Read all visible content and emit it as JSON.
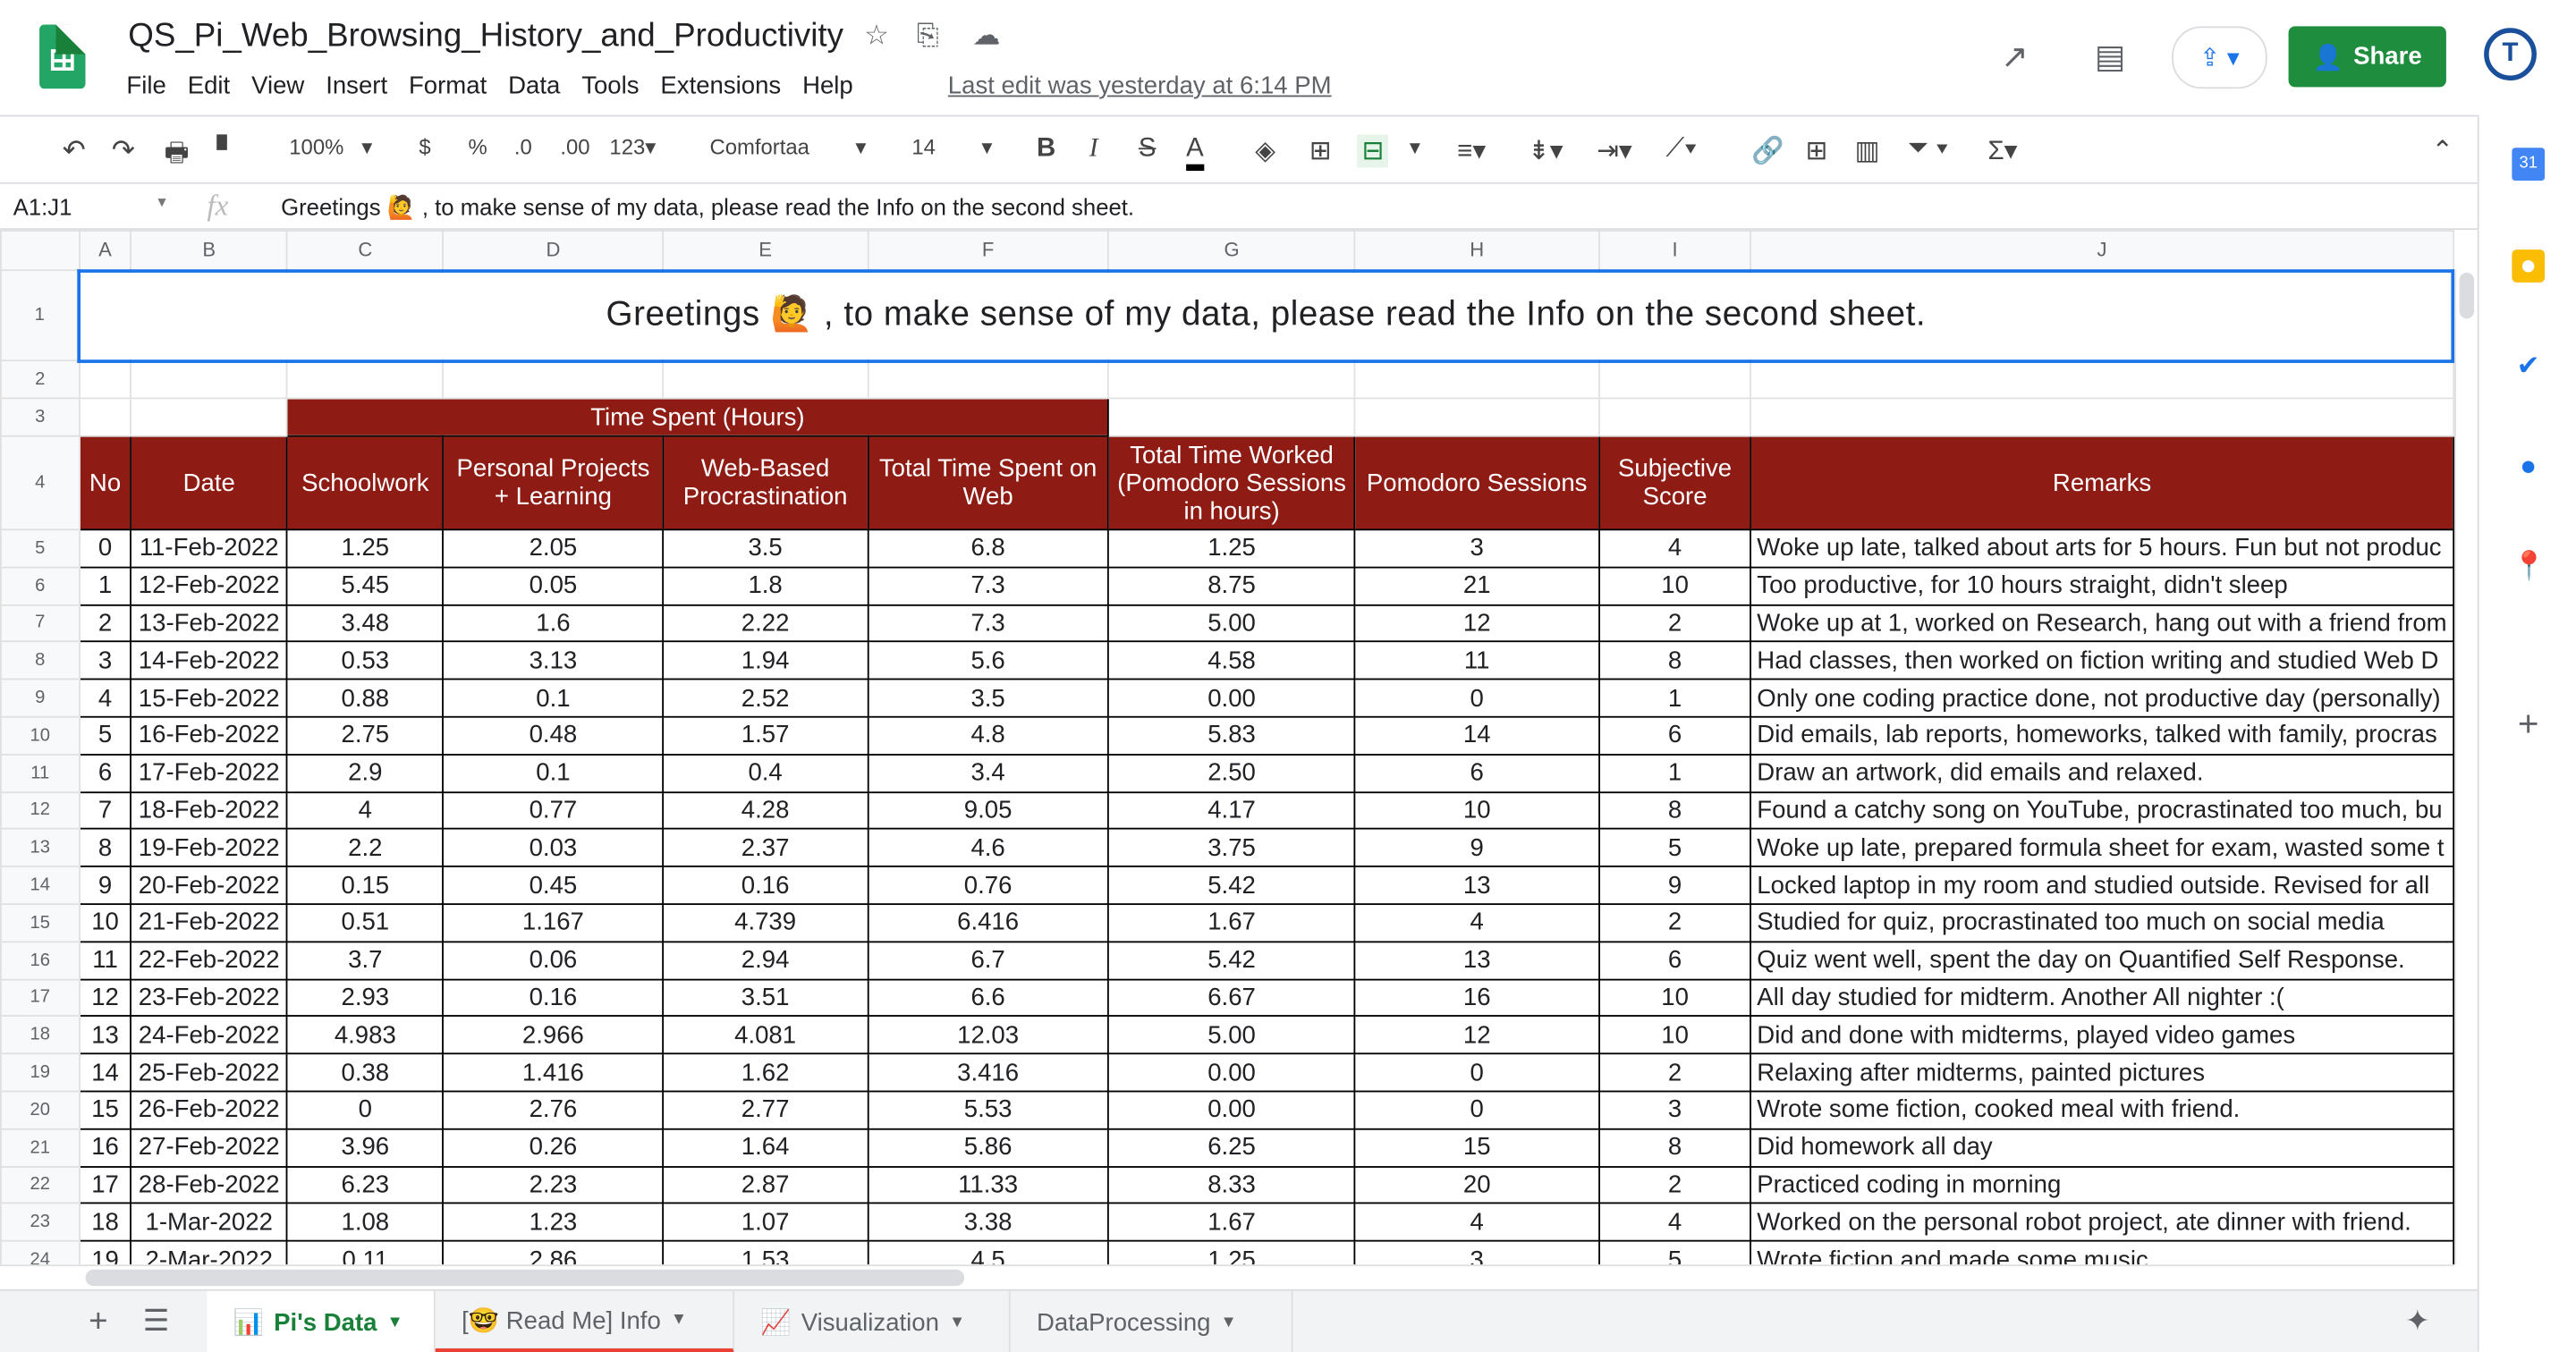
{
  "app": {
    "title": "QS_Pi_Web_Browsing_History_and_Productivity",
    "last_edit": "Last edit was yesterday at 6:14 PM",
    "share_label": "Share",
    "avatar_initials": "T",
    "menu": [
      "File",
      "Edit",
      "View",
      "Insert",
      "Format",
      "Data",
      "Tools",
      "Extensions",
      "Help"
    ]
  },
  "toolbar": {
    "zoom": "100%",
    "currency": "$",
    "percent": "%",
    "dec_less": ".0",
    "dec_more": ".00",
    "format_more": "123",
    "font": "Comfortaa",
    "font_size": "14",
    "bold": "B",
    "italic": "I",
    "strike": "S",
    "text_color": "A"
  },
  "formula_bar": {
    "name_box": "A1:J1",
    "fx": "fx",
    "content": "Greetings 🙋 , to make sense of my data, please read the Info on the second sheet."
  },
  "sheet": {
    "columns": [
      "A",
      "B",
      "C",
      "D",
      "E",
      "F",
      "G",
      "H",
      "I",
      "J"
    ],
    "banner": "Greetings 🙋 , to make sense of my data, please read the Info on the second sheet.",
    "group_header": "Time Spent (Hours)",
    "headers": [
      "No",
      "Date",
      "Schoolwork",
      "Personal Projects + Learning",
      "Web-Based Procrastination",
      "Total Time Spent on Web",
      "Total Time Worked (Pomodoro Sessions in hours)",
      "Pomodoro Sessions",
      "Subjective Score",
      "Remarks"
    ],
    "rows": [
      [
        "0",
        "11-Feb-2022",
        "1.25",
        "2.05",
        "3.5",
        "6.8",
        "1.25",
        "3",
        "4",
        "Woke up late, talked about arts for 5 hours. Fun but not produc"
      ],
      [
        "1",
        "12-Feb-2022",
        "5.45",
        "0.05",
        "1.8",
        "7.3",
        "8.75",
        "21",
        "10",
        "Too productive, for 10 hours straight, didn't sleep"
      ],
      [
        "2",
        "13-Feb-2022",
        "3.48",
        "1.6",
        "2.22",
        "7.3",
        "5.00",
        "12",
        "2",
        "Woke up at 1, worked on Research, hang out with a friend from"
      ],
      [
        "3",
        "14-Feb-2022",
        "0.53",
        "3.13",
        "1.94",
        "5.6",
        "4.58",
        "11",
        "8",
        "Had classes, then worked on fiction writing and studied Web D"
      ],
      [
        "4",
        "15-Feb-2022",
        "0.88",
        "0.1",
        "2.52",
        "3.5",
        "0.00",
        "0",
        "1",
        "Only one coding practice done, not productive day (personally)"
      ],
      [
        "5",
        "16-Feb-2022",
        "2.75",
        "0.48",
        "1.57",
        "4.8",
        "5.83",
        "14",
        "6",
        "Did emails, lab reports, homeworks, talked with family, procras"
      ],
      [
        "6",
        "17-Feb-2022",
        "2.9",
        "0.1",
        "0.4",
        "3.4",
        "2.50",
        "6",
        "1",
        "Draw an artwork, did emails and relaxed."
      ],
      [
        "7",
        "18-Feb-2022",
        "4",
        "0.77",
        "4.28",
        "9.05",
        "4.17",
        "10",
        "8",
        "Found a catchy song on YouTube, procrastinated too much, bu"
      ],
      [
        "8",
        "19-Feb-2022",
        "2.2",
        "0.03",
        "2.37",
        "4.6",
        "3.75",
        "9",
        "5",
        "Woke up late, prepared formula sheet for exam, wasted some t"
      ],
      [
        "9",
        "20-Feb-2022",
        "0.15",
        "0.45",
        "0.16",
        "0.76",
        "5.42",
        "13",
        "9",
        "Locked laptop in my room and studied outside. Revised for all"
      ],
      [
        "10",
        "21-Feb-2022",
        "0.51",
        "1.167",
        "4.739",
        "6.416",
        "1.67",
        "4",
        "2",
        "Studied for quiz, procrastinated too much on social media"
      ],
      [
        "11",
        "22-Feb-2022",
        "3.7",
        "0.06",
        "2.94",
        "6.7",
        "5.42",
        "13",
        "6",
        "Quiz went well, spent the day on Quantified Self Response."
      ],
      [
        "12",
        "23-Feb-2022",
        "2.93",
        "0.16",
        "3.51",
        "6.6",
        "6.67",
        "16",
        "10",
        "All day studied for midterm. Another All nighter :("
      ],
      [
        "13",
        "24-Feb-2022",
        "4.983",
        "2.966",
        "4.081",
        "12.03",
        "5.00",
        "12",
        "10",
        "Did and done with midterms, played video games"
      ],
      [
        "14",
        "25-Feb-2022",
        "0.38",
        "1.416",
        "1.62",
        "3.416",
        "0.00",
        "0",
        "2",
        "Relaxing after midterms, painted pictures"
      ],
      [
        "15",
        "26-Feb-2022",
        "0",
        "2.76",
        "2.77",
        "5.53",
        "0.00",
        "0",
        "3",
        "Wrote some fiction, cooked meal with friend."
      ],
      [
        "16",
        "27-Feb-2022",
        "3.96",
        "0.26",
        "1.64",
        "5.86",
        "6.25",
        "15",
        "8",
        "Did homework all day"
      ],
      [
        "17",
        "28-Feb-2022",
        "6.23",
        "2.23",
        "2.87",
        "11.33",
        "8.33",
        "20",
        "2",
        "Practiced coding in morning"
      ],
      [
        "18",
        "1-Mar-2022",
        "1.08",
        "1.23",
        "1.07",
        "3.38",
        "1.67",
        "4",
        "4",
        "Worked on the personal robot project, ate dinner with friend."
      ],
      [
        "19",
        "2-Mar-2022",
        "0.11",
        "2.86",
        "1.53",
        "4.5",
        "1.25",
        "3",
        "5",
        "Wrote fiction and made some music"
      ]
    ]
  },
  "tabs": [
    {
      "label": "Pi's Data",
      "icon": "📊"
    },
    {
      "label": "[🤓 Read Me] Info",
      "icon": ""
    },
    {
      "label": "Visualization",
      "icon": "📈"
    },
    {
      "label": "DataProcessing",
      "icon": ""
    }
  ],
  "colors": {
    "header_red": "#8e1b14",
    "active_tab_green": "#188038",
    "share_green": "#1e8e3e"
  }
}
